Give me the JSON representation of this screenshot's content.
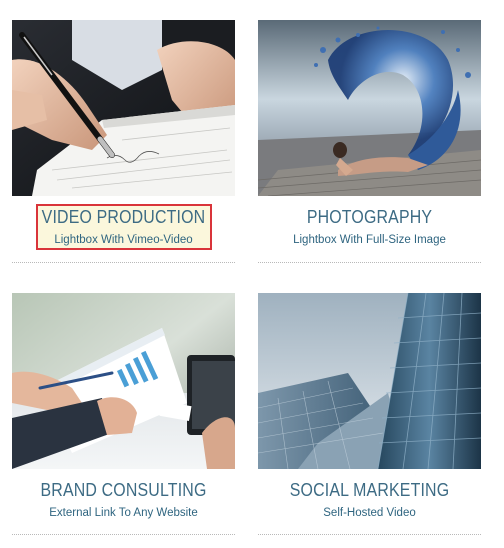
{
  "portfolio": {
    "items": [
      {
        "title": "VIDEO PRODUCTION",
        "subtitle": "Lightbox With Vimeo-Video",
        "image": "hand-signing-document"
      },
      {
        "title": "PHOTOGRAPHY",
        "subtitle": "Lightbox With Full-Size Image",
        "image": "dancer-with-water-splash"
      },
      {
        "title": "BRAND CONSULTING",
        "subtitle": "External Link To Any Website",
        "image": "business-charts-tablet"
      },
      {
        "title": "SOCIAL MARKETING",
        "subtitle": "Self-Hosted Video",
        "image": "glass-skyscrapers"
      }
    ],
    "highlighted_index": 0,
    "colors": {
      "title": "#3d6b84",
      "subtitle": "#2f6580",
      "highlight_bg": "#fbf7dc",
      "highlight_border": "#d9343a"
    }
  }
}
